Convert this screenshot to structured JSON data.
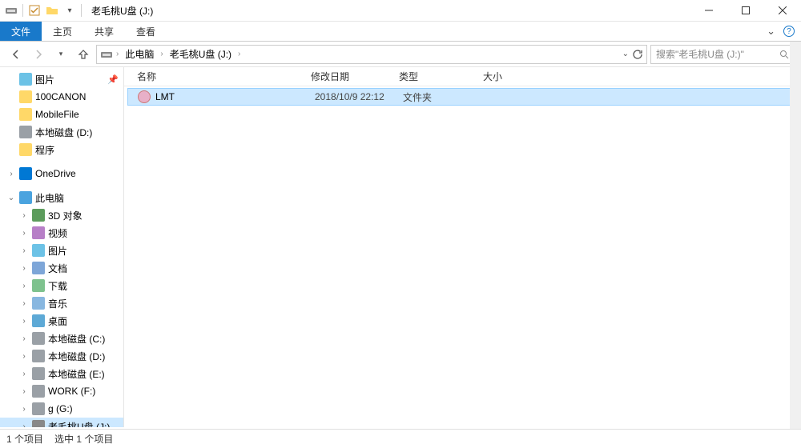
{
  "window_title": "老毛桃U盘 (J:)",
  "ribbon": {
    "file": "文件",
    "tabs": [
      "主页",
      "共享",
      "查看"
    ]
  },
  "breadcrumb": {
    "segments": [
      "此电脑",
      "老毛桃U盘 (J:)"
    ]
  },
  "search": {
    "placeholder": "搜索\"老毛桃U盘 (J:)\""
  },
  "nav_tree": [
    {
      "level": 1,
      "icon": "folder-img",
      "label": "图片",
      "expand": "hidden",
      "pin": true
    },
    {
      "level": 1,
      "icon": "folder",
      "label": "100CANON",
      "expand": "hidden"
    },
    {
      "level": 1,
      "icon": "folder",
      "label": "MobileFile",
      "expand": "hidden"
    },
    {
      "level": 1,
      "icon": "drive",
      "label": "本地磁盘 (D:)",
      "expand": "hidden"
    },
    {
      "level": 1,
      "icon": "folder",
      "label": "程序",
      "expand": "hidden"
    },
    {
      "level": 0,
      "icon": "spacer"
    },
    {
      "level": 1,
      "icon": "onedrive",
      "label": "OneDrive",
      "expand": "right"
    },
    {
      "level": 0,
      "icon": "spacer"
    },
    {
      "level": 1,
      "icon": "pc",
      "label": "此电脑",
      "expand": "down"
    },
    {
      "level": 2,
      "icon": "obj3d",
      "label": "3D 对象",
      "expand": "right"
    },
    {
      "level": 2,
      "icon": "video",
      "label": "视频",
      "expand": "right"
    },
    {
      "level": 2,
      "icon": "folder-img",
      "label": "图片",
      "expand": "right"
    },
    {
      "level": 2,
      "icon": "doc",
      "label": "文档",
      "expand": "right"
    },
    {
      "level": 2,
      "icon": "down",
      "label": "下载",
      "expand": "right"
    },
    {
      "level": 2,
      "icon": "music",
      "label": "音乐",
      "expand": "right"
    },
    {
      "level": 2,
      "icon": "desktop",
      "label": "桌面",
      "expand": "right"
    },
    {
      "level": 2,
      "icon": "drive",
      "label": "本地磁盘 (C:)",
      "expand": "right"
    },
    {
      "level": 2,
      "icon": "drive",
      "label": "本地磁盘 (D:)",
      "expand": "right"
    },
    {
      "level": 2,
      "icon": "drive",
      "label": "本地磁盘 (E:)",
      "expand": "right"
    },
    {
      "level": 2,
      "icon": "drive",
      "label": "WORK (F:)",
      "expand": "right"
    },
    {
      "level": 2,
      "icon": "drive",
      "label": "g (G:)",
      "expand": "right"
    },
    {
      "level": 2,
      "icon": "usb",
      "label": "老毛桃U盘 (J:)",
      "expand": "right",
      "selected": true
    }
  ],
  "columns": {
    "name": "名称",
    "date": "修改日期",
    "type": "类型",
    "size": "大小"
  },
  "files": [
    {
      "name": "LMT",
      "date": "2018/10/9 22:12",
      "type": "文件夹",
      "size": ""
    }
  ],
  "status": {
    "count": "1 个项目",
    "selected": "选中 1 个项目"
  }
}
